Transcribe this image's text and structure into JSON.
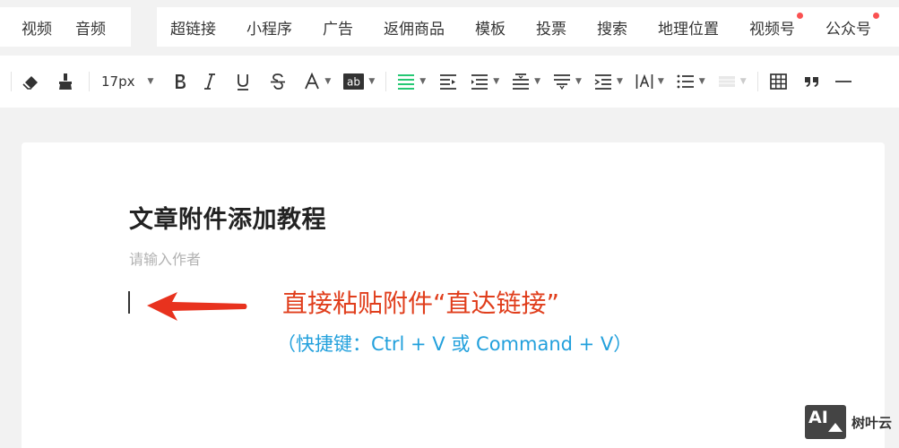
{
  "insert_bar": {
    "group1": [
      "视频",
      "音频"
    ],
    "group2": [
      {
        "label": "超链接",
        "dot": false
      },
      {
        "label": "小程序",
        "dot": false
      },
      {
        "label": "广告",
        "dot": false
      },
      {
        "label": "返佣商品",
        "dot": false
      },
      {
        "label": "模板",
        "dot": false
      },
      {
        "label": "投票",
        "dot": false
      },
      {
        "label": "搜索",
        "dot": false
      },
      {
        "label": "地理位置",
        "dot": false
      },
      {
        "label": "视频号",
        "dot": true
      },
      {
        "label": "公众号",
        "dot": true
      }
    ]
  },
  "toolbar": {
    "font_size": "17px",
    "icons": [
      "format-clear-icon",
      "format-painter-icon",
      "bold-icon",
      "italic-icon",
      "underline-icon",
      "strikethrough-icon",
      "font-color-icon",
      "background-color-icon",
      "align-icon",
      "first-line-indent-icon",
      "paragraph-spacing-before-icon",
      "paragraph-spacing-after-icon",
      "line-height-icon",
      "indent-icon",
      "letter-spacing-icon",
      "list-icon",
      "border-icon",
      "table-icon",
      "quote-icon",
      "divider-icon"
    ],
    "active_color": "#07c160"
  },
  "editor": {
    "title": "文章附件添加教程",
    "author_placeholder": "请输入作者",
    "hint_main": "直接粘贴附件“直达链接”",
    "hint_sub": "（快捷键：Ctrl + V 或 Command + V）"
  },
  "watermark": {
    "logo_text": "AI",
    "brand": "树叶云"
  },
  "colors": {
    "hint_main": "#e03e1c",
    "hint_sub": "#22a0dc",
    "arrow": "#e8321e",
    "badge": "#fa5151"
  }
}
